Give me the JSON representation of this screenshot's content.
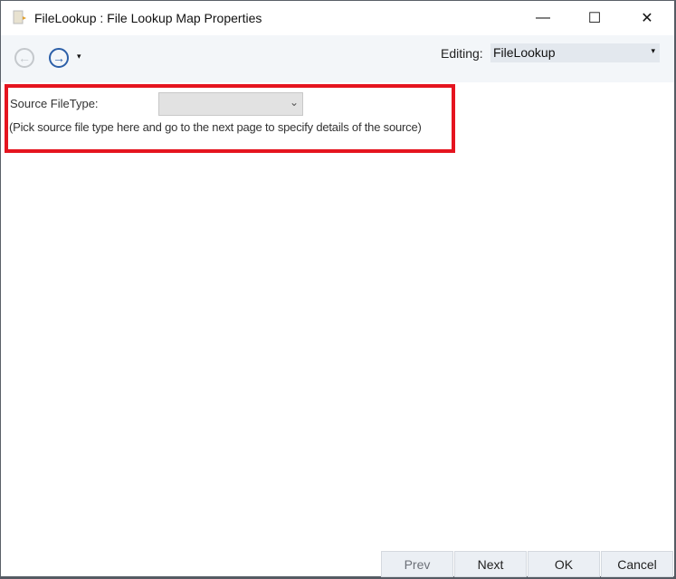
{
  "window": {
    "title": "FileLookup : File Lookup Map Properties",
    "minimize": "—",
    "maximize": "☐",
    "close": "✕"
  },
  "toolbar": {
    "back": "←",
    "forward": "→",
    "dropdown": "▾",
    "editing_label": "Editing:",
    "editing_value": "FileLookup",
    "editing_arrow": "▾"
  },
  "form": {
    "source_label": "Source FileType:",
    "source_value": "",
    "hint": "(Pick source file type here and  go to the next page to specify details of the source)",
    "combo_arrow": "⌄",
    "highlight_color": "#e5141f"
  },
  "buttons": {
    "prev": "Prev",
    "next": "Next",
    "ok": "OK",
    "cancel": "Cancel"
  }
}
